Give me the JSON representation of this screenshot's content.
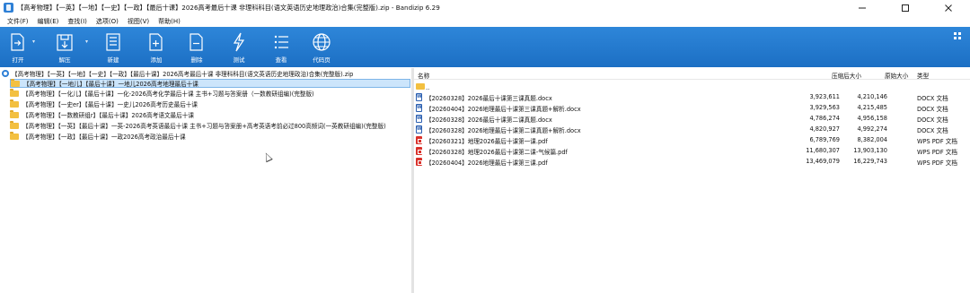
{
  "window": {
    "title": "【高考物理】【一英】【一地】【一史】【一政】【最后十课】2026高考最后十课  非理科科目(语文英语历史地理政治)合集(完整版).zip - Bandizip 6.29",
    "minimize_icon": "minimize-icon",
    "maximize_icon": "maximize-icon",
    "close_icon": "close-icon"
  },
  "menu": {
    "items": [
      "文件(F)",
      "编辑(E)",
      "查找(I)",
      "选项(O)",
      "视图(V)",
      "帮助(H)"
    ]
  },
  "toolbar": {
    "accent": "#2479cf",
    "buttons": [
      {
        "label": "打开",
        "icon": "open-icon"
      },
      {
        "label": "解压",
        "icon": "extract-icon"
      },
      {
        "label": "新建",
        "icon": "new-archive-icon"
      },
      {
        "label": "添加",
        "icon": "add-icon"
      },
      {
        "label": "删除",
        "icon": "delete-icon"
      },
      {
        "label": "测试",
        "icon": "test-icon"
      },
      {
        "label": "查看",
        "icon": "view-icon"
      },
      {
        "label": "代码页",
        "icon": "codepage-icon"
      }
    ]
  },
  "tree": {
    "root": "【高考物理】【一英】【一地】【一史】【一政】【最后十课】2026高考最后十课  非理科科目(语文英语历史地理政治)合集(完整版).zip",
    "folders": [
      {
        "label": "【高考物理】【一地儿】【最后十课】一地儿2026高考地理最后十课",
        "selected": true
      },
      {
        "label": "【高考物理】【一化儿】【最后十课】一化-2026高考化学最后十课 主书+习题与答案册（一数教研组编)(完整版)",
        "selected": false
      },
      {
        "label": "【高考物理】【一史er】【最后十课】一史儿2026高考历史最后十课",
        "selected": false
      },
      {
        "label": "【高考物理】【一数教研组r】【最后十课】2026高考语文最后十课",
        "selected": false
      },
      {
        "label": "【高考物理】【一英】【最后十课】一英-2026高考英语最后十课 主书+习题与答案册+高考英语考前必过800高频词(一英教研组编)(完整版)",
        "selected": false
      },
      {
        "label": "【高考物理】【一政】【最后十课】一政2026高考政治最后十课",
        "selected": false
      }
    ]
  },
  "file_list": {
    "columns": {
      "name": "名称",
      "packed": "压缩后大小",
      "size": "原始大小",
      "type": "类型"
    },
    "parent_label": "..",
    "files": [
      {
        "name": "【20260328】2026最后十课第三课真题.docx",
        "packed": "3,923,611",
        "size": "4,210,146",
        "type": "DOCX 文档",
        "kind": "docx"
      },
      {
        "name": "【20260404】2026地理最后十课第三课真题+解析.docx",
        "packed": "3,929,563",
        "size": "4,215,485",
        "type": "DOCX 文档",
        "kind": "docx"
      },
      {
        "name": "【20260328】2026最后十课第二课真题.docx",
        "packed": "4,786,274",
        "size": "4,956,158",
        "type": "DOCX 文档",
        "kind": "docx"
      },
      {
        "name": "【20260328】2026地理最后十课第二课真题+解析.docx",
        "packed": "4,820,927",
        "size": "4,992,274",
        "type": "DOCX 文档",
        "kind": "docx"
      },
      {
        "name": "【20260321】地理2026最后十课第一课.pdf",
        "packed": "6,789,769",
        "size": "8,382,004",
        "type": "WPS PDF 文档",
        "kind": "pdf"
      },
      {
        "name": "【20260328】地理2026最后十课第二课-气候篇.pdf",
        "packed": "11,680,307",
        "size": "13,903,130",
        "type": "WPS PDF 文档",
        "kind": "pdf"
      },
      {
        "name": "【20260404】2026地理最后十课第三课.pdf",
        "packed": "13,469,079",
        "size": "16,229,743",
        "type": "WPS PDF 文档",
        "kind": "pdf"
      }
    ]
  }
}
